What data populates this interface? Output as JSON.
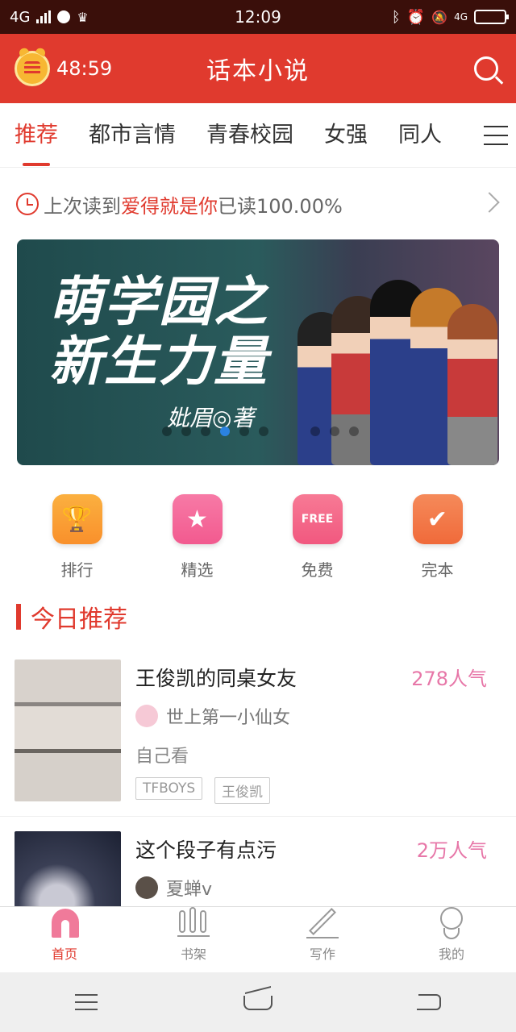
{
  "status_bar": {
    "network": "4G",
    "time": "12:09",
    "network_right": "4G"
  },
  "header": {
    "timer": "48:59",
    "title": "话本小说",
    "icons": {
      "timer": "coin-clock-icon",
      "search": "search-icon"
    }
  },
  "tabs": [
    {
      "label": "推荐",
      "active": true
    },
    {
      "label": "都市言情",
      "active": false
    },
    {
      "label": "青春校园",
      "active": false
    },
    {
      "label": "女强",
      "active": false
    },
    {
      "label": "同人",
      "active": false
    }
  ],
  "last_read": {
    "prefix": "上次读到",
    "book": "爱得就是你",
    "progress": "已读100.00%"
  },
  "banner": {
    "title_line1": "萌学园之",
    "title_line2": "新生力量",
    "author": "妣眉◎著",
    "slide_count": 10,
    "active_slide": 4
  },
  "quick_entries": [
    {
      "label": "排行",
      "icon": "trophy-icon",
      "color": "#f9902b"
    },
    {
      "label": "精选",
      "icon": "star-icon",
      "color": "#f25a8f"
    },
    {
      "label": "免费",
      "icon": "free-icon",
      "color": "#f1587f",
      "badge": "FREE"
    },
    {
      "label": "完本",
      "icon": "check-book-icon",
      "color": "#f06a3a"
    }
  ],
  "section_title": "今日推荐",
  "books": [
    {
      "title": "王俊凯的同桌女友",
      "popularity": "278人气",
      "author": "世上第一小仙女",
      "description": "自己看",
      "tags": [
        "TFBOYS",
        "王俊凯"
      ]
    },
    {
      "title": "这个段子有点污",
      "popularity": "2万人气",
      "author": "夏蝉v",
      "description": "",
      "tags": []
    }
  ],
  "bottom_nav": [
    {
      "label": "首页",
      "icon": "home-icon",
      "active": true
    },
    {
      "label": "书架",
      "icon": "bookshelf-icon",
      "active": false
    },
    {
      "label": "写作",
      "icon": "pencil-icon",
      "active": false
    },
    {
      "label": "我的",
      "icon": "profile-icon",
      "active": false
    }
  ],
  "colors": {
    "accent": "#e03a2e",
    "popularity": "#e777a8",
    "active_dot": "#2b82e0"
  }
}
